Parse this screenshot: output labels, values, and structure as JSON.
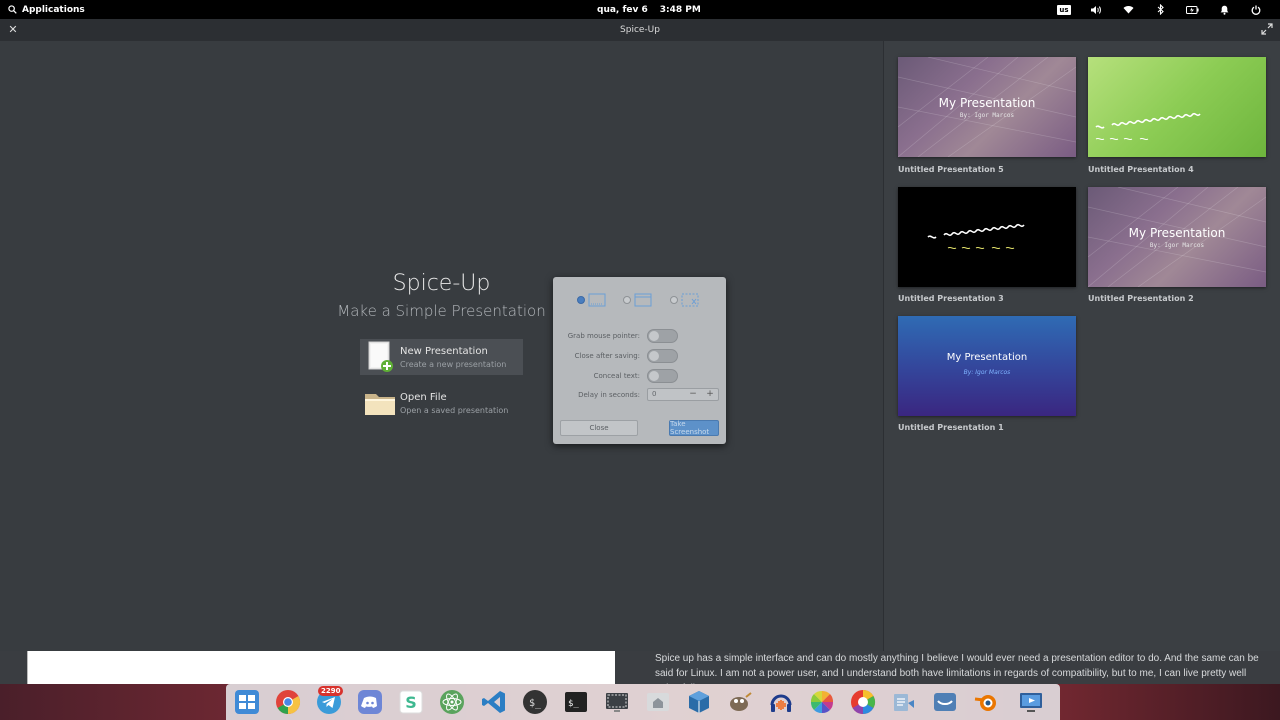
{
  "panel": {
    "applications_label": "Applications",
    "date": "qua, fev  6",
    "time": "3:48 PM",
    "keyboard_layout": "us"
  },
  "window": {
    "title": "Spice-Up"
  },
  "welcome": {
    "title": "Spice-Up",
    "subtitle": "Make a Simple Presentation",
    "actions": [
      {
        "title": "New Presentation",
        "description": "Create a new presentation"
      },
      {
        "title": "Open File",
        "description": "Open a saved presentation"
      }
    ]
  },
  "recent": [
    {
      "label": "Untitled Presentation 5",
      "slide_title": "My Presentation",
      "slide_subtitle": "By: Igor Marcos",
      "style": "purple-photo"
    },
    {
      "label": "Untitled Presentation 4",
      "slide_title": "",
      "slide_subtitle": "",
      "style": "green"
    },
    {
      "label": "Untitled Presentation 3",
      "slide_title": "",
      "slide_subtitle": "",
      "style": "black"
    },
    {
      "label": "Untitled Presentation 2",
      "slide_title": "My Presentation",
      "slide_subtitle": "By: Igor Marcos",
      "style": "purple-photo"
    },
    {
      "label": "Untitled Presentation 1",
      "slide_title": "My Presentation",
      "slide_subtitle": "By: Igor Marcos",
      "style": "blue"
    }
  ],
  "screenshot_dialog": {
    "options": [
      {
        "label": "Grab mouse pointer:",
        "on": false
      },
      {
        "label": "Close after saving:",
        "on": false
      },
      {
        "label": "Conceal text:",
        "on": false
      }
    ],
    "delay_label": "Delay in seconds:",
    "delay_value": "0",
    "close_label": "Close",
    "take_label": "Take Screenshot"
  },
  "background_article": {
    "text": "Spice up has a simple interface and can do mostly anything I believe I would ever need a presentation editor to do. And the same can be said for Linux. I am not a power user, and I understand both have limitations in regards of compatibility, but to me, I can live pretty well going full open source."
  },
  "dock": {
    "telegram_badge": "2290",
    "items": [
      "multitasking-view",
      "chrome",
      "telegram",
      "discord",
      "slack",
      "atom",
      "vscode",
      "terminal-alt",
      "terminal",
      "screenshot",
      "files",
      "virtualbox",
      "gimp",
      "audacity",
      "photos",
      "color-picker",
      "notes",
      "mail",
      "blender",
      "screen-recorder"
    ]
  },
  "colors": {
    "accent": "#5d91c9",
    "window_bg": "#383c40",
    "sidebar_bg": "#3b3f43"
  }
}
